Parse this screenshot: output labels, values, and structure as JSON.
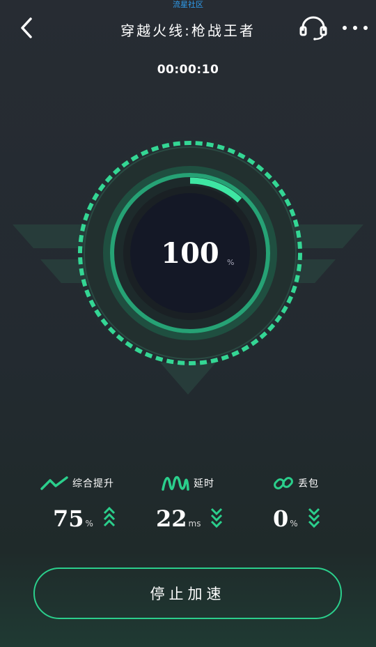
{
  "watermark": "流星社区",
  "header": {
    "title": "穿越火线:枪战王者",
    "back_icon": "chevron-left-icon",
    "support_icon": "headset-icon",
    "more_icon": "more-dots-icon"
  },
  "timer": "00:00:10",
  "gauge": {
    "value": "100",
    "unit": "%",
    "progress_fraction": 0.12
  },
  "stats": [
    {
      "icon": "trend-up-icon",
      "label": "综合提升",
      "value": "75",
      "unit": "%",
      "trend": "up"
    },
    {
      "icon": "wave-icon",
      "label": "延时",
      "value": "22",
      "unit": "ms",
      "trend": "down"
    },
    {
      "icon": "link-icon",
      "label": "丢包",
      "value": "0",
      "unit": "%",
      "trend": "down"
    }
  ],
  "stop_button": {
    "label": "停止加速"
  },
  "colors": {
    "accent": "#2bcf8c",
    "accent_light": "#3ee6a3",
    "background": "#262c33",
    "gauge_inner": "#141826"
  }
}
